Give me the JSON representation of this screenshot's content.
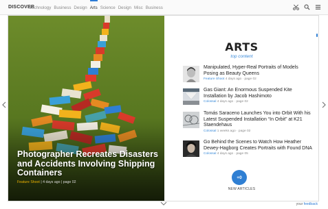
{
  "nav": {
    "brand": "DISCOVER",
    "items": [
      {
        "label": "Technology",
        "active": false
      },
      {
        "label": "Business",
        "active": false
      },
      {
        "label": "Design",
        "active": false
      },
      {
        "label": "Arts",
        "active": true
      },
      {
        "label": "Science",
        "active": false
      },
      {
        "label": "Design",
        "active": false
      },
      {
        "label": "Misc",
        "active": false
      },
      {
        "label": "Business",
        "active": false
      }
    ],
    "tools": [
      "scissors-icon",
      "search-icon",
      "menu-icon"
    ]
  },
  "feature": {
    "title": "Photographer Recreates Disasters and Accidents Involving Shipping Containers",
    "source": "Feature Shoot",
    "meta": " | 4 days ago | page 02"
  },
  "section": {
    "title": "ARTS",
    "subtitle": "top content"
  },
  "articles": [
    {
      "title": "Manipulated, Hyper-Real Portraits of Models Posing as Beauty Queens",
      "source": "Feature Shoot",
      "meta": " 4 days ago · page 02"
    },
    {
      "title": "Gas Giant: An Enormous Suspended Kite Installation by Jacob Hashimoto",
      "source": "Colossal",
      "meta": " 4 days ago · page 02"
    },
    {
      "title": "Tomás Saraceno Launches You into Orbit With his Latest Suspended Installation “In Orbit” at K21 Staendehaus",
      "source": "Colossal",
      "meta": " 1 weeks ago · page 02"
    },
    {
      "title": "Go Behind the Scenes to Watch How Heather Dewey-Hagborg Creates Portraits with Found DNA",
      "source": "Colossal",
      "meta": " 4 days ago · page 05"
    }
  ],
  "new_articles": {
    "count": "+0",
    "label": "NEW ARTICLES"
  },
  "footer": {
    "prefix": "your ",
    "link": "feedback"
  },
  "colors": {
    "accent": "#2f7fd3",
    "feature_background": "#5e7d24",
    "feature_source": "#f0b400"
  }
}
